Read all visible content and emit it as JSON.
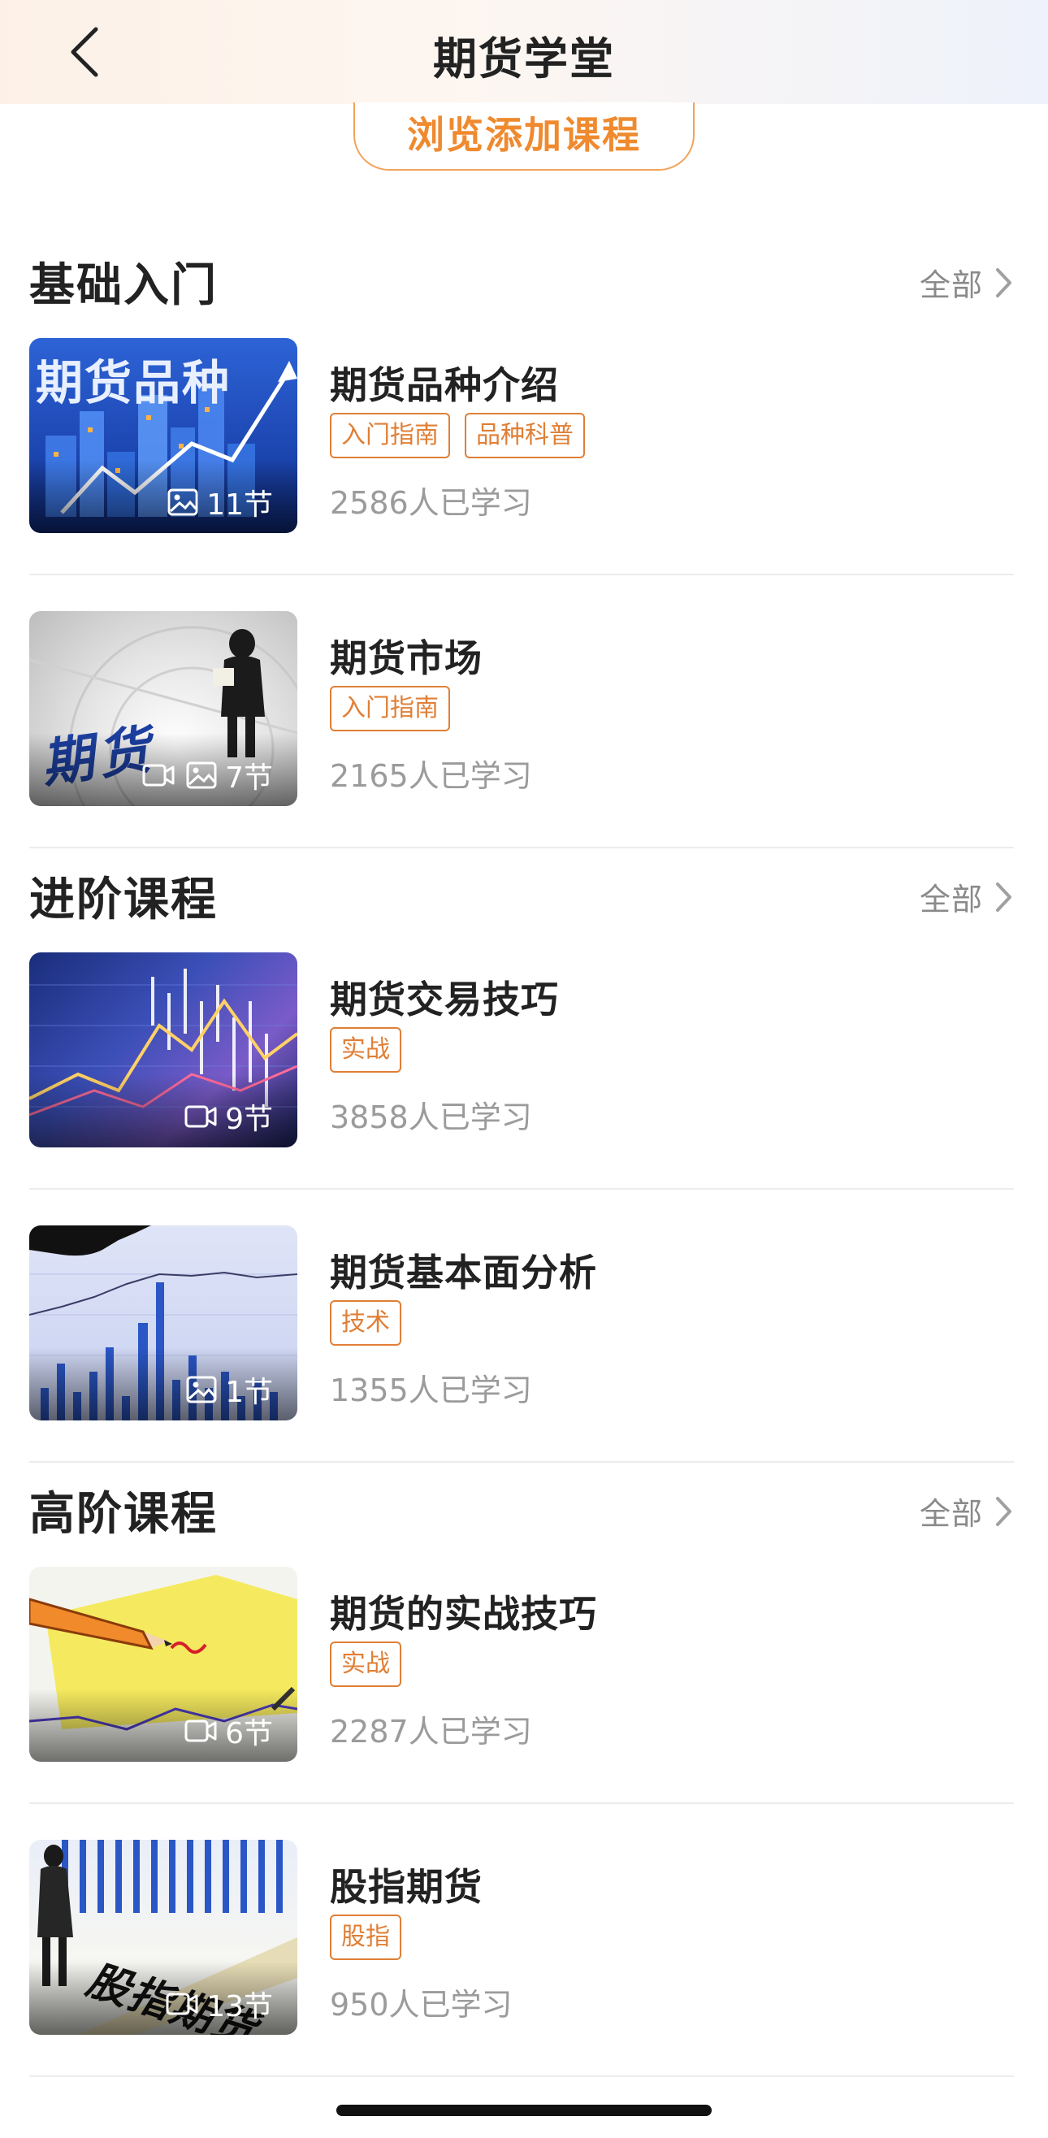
{
  "header": {
    "title": "期货学堂"
  },
  "browse_button": {
    "label": "浏览添加课程"
  },
  "sections": [
    {
      "title": "基础入门",
      "all_label": "全部",
      "courses": [
        {
          "title": "期货品种介绍",
          "tags": [
            "入门指南",
            "品种科普"
          ],
          "learners": "2586人已学习",
          "lessons": "11节",
          "thumb_text": "期货品种"
        },
        {
          "title": "期货市场",
          "tags": [
            "入门指南"
          ],
          "learners": "2165人已学习",
          "lessons": "7节",
          "thumb_text": "期货"
        }
      ]
    },
    {
      "title": "进阶课程",
      "all_label": "全部",
      "courses": [
        {
          "title": "期货交易技巧",
          "tags": [
            "实战"
          ],
          "learners": "3858人已学习",
          "lessons": "9节"
        },
        {
          "title": "期货基本面分析",
          "tags": [
            "技术"
          ],
          "learners": "1355人已学习",
          "lessons": "1节"
        }
      ]
    },
    {
      "title": "高阶课程",
      "all_label": "全部",
      "courses": [
        {
          "title": "期货的实战技巧",
          "tags": [
            "实战"
          ],
          "learners": "2287人已学习",
          "lessons": "6节"
        },
        {
          "title": "股指期货",
          "tags": [
            "股指"
          ],
          "learners": "950人已学习",
          "lessons": "13节",
          "thumb_text": "股指期货"
        }
      ]
    }
  ],
  "colors": {
    "accent": "#ef8a2f",
    "tag": "#e07f36",
    "muted": "#9b9b9b"
  }
}
